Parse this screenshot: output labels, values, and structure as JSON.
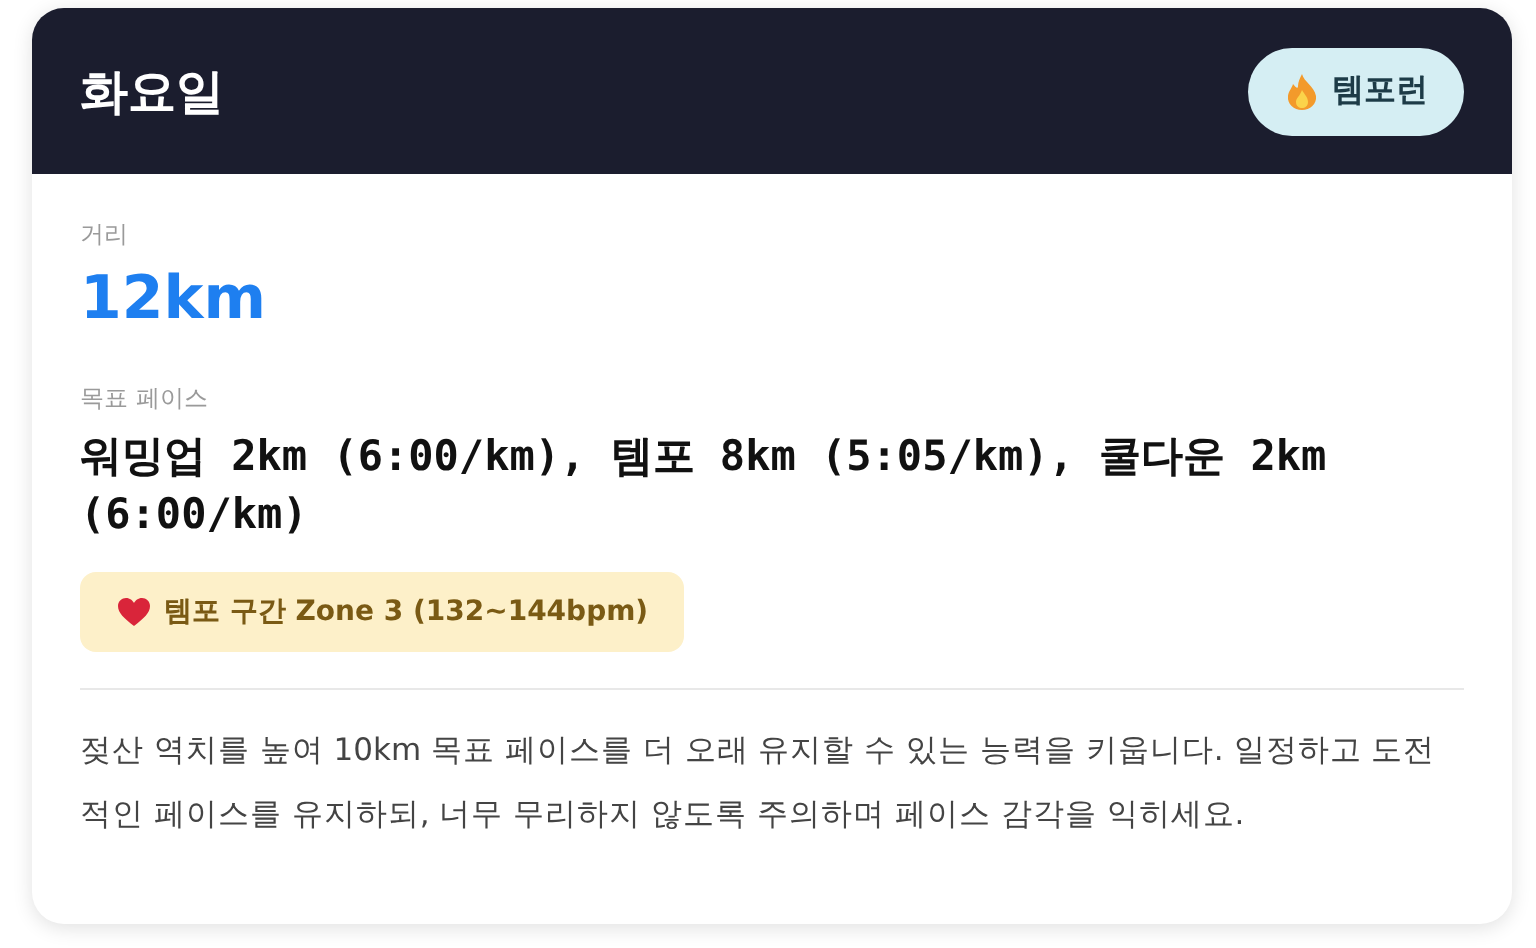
{
  "header": {
    "title": "화요일",
    "badge": "템포런"
  },
  "distance": {
    "label": "거리",
    "value": "12km"
  },
  "pace": {
    "label": "목표 페이스",
    "value": "워밍업 2km (6:00/km), 템포 8km (5:05/km), 쿨다운 2km (6:00/km)"
  },
  "zone": {
    "text": "템포 구간 Zone 3 (132~144bpm)"
  },
  "description": "젖산 역치를 높여 10km 목표 페이스를 더 오래 유지할 수 있는 능력을 키웁니다. 일정하고 도전적인 페이스를 유지하되, 너무 무리하지 않도록 주의하며 페이스 감각을 익히세요."
}
